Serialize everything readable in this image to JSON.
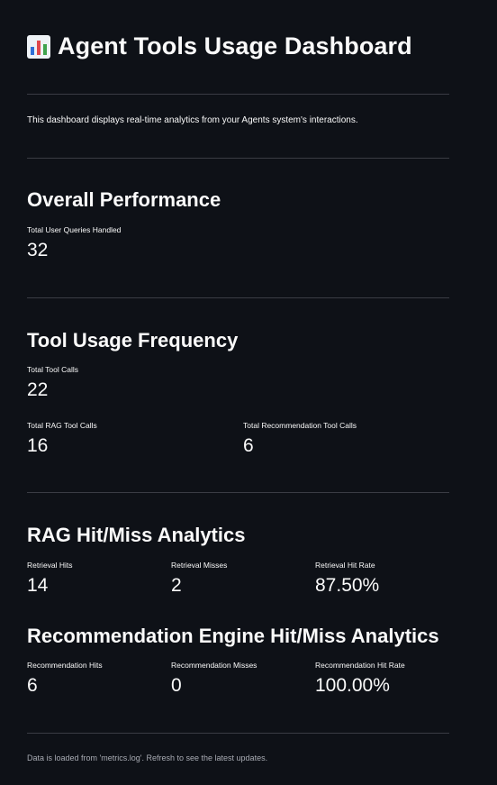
{
  "header": {
    "title": "Agent Tools Usage Dashboard",
    "icon": "bar-chart-icon"
  },
  "intro": "This dashboard displays real-time analytics from your Agents system's interactions.",
  "overall": {
    "heading": "Overall Performance",
    "total_queries": {
      "label": "Total User Queries Handled",
      "value": "32"
    }
  },
  "tool_usage": {
    "heading": "Tool Usage Frequency",
    "total_tool_calls": {
      "label": "Total Tool Calls",
      "value": "22"
    },
    "rag_calls": {
      "label": "Total RAG Tool Calls",
      "value": "16"
    },
    "rec_calls": {
      "label": "Total Recommendation Tool Calls",
      "value": "6"
    }
  },
  "rag": {
    "heading": "RAG Hit/Miss Analytics",
    "hits": {
      "label": "Retrieval Hits",
      "value": "14"
    },
    "misses": {
      "label": "Retrieval Misses",
      "value": "2"
    },
    "hit_rate": {
      "label": "Retrieval Hit Rate",
      "value": "87.50%"
    }
  },
  "recommendation": {
    "heading": "Recommendation Engine Hit/Miss Analytics",
    "hits": {
      "label": "Recommendation Hits",
      "value": "6"
    },
    "misses": {
      "label": "Recommendation Misses",
      "value": "0"
    },
    "hit_rate": {
      "label": "Recommendation Hit Rate",
      "value": "100.00%"
    }
  },
  "footer": "Data is loaded from 'metrics.log'. Refresh to see the latest updates.",
  "colors": {
    "background": "#0e1117",
    "text": "#fafafa",
    "divider": "#3a3c44",
    "icon_red": "#e0474c",
    "icon_green": "#3fa34d",
    "icon_blue": "#2f6fd6"
  }
}
